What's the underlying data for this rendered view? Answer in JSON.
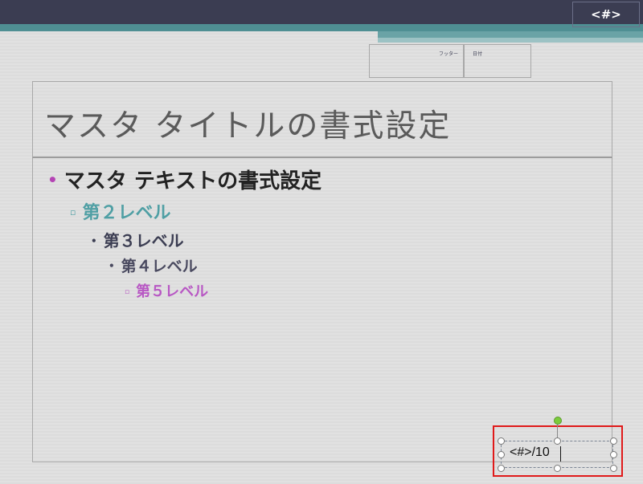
{
  "header": {
    "slide_number_placeholder": "<#>"
  },
  "footer_boxes": {
    "footer_label": "フッター",
    "date_label": "日付"
  },
  "title": {
    "text": "マスタ タイトルの書式設定"
  },
  "body_levels": [
    {
      "bullet": "•",
      "text": "マスタ テキストの書式設定"
    },
    {
      "bullet": "▫",
      "text": "第２レベル"
    },
    {
      "bullet": "•",
      "text": "第３レベル"
    },
    {
      "bullet": "•",
      "text": "第４レベル"
    },
    {
      "bullet": "▫",
      "text": "第５レベル"
    }
  ],
  "selected_textbox": {
    "text": "<#>/10"
  },
  "colors": {
    "header_bar": "#3b3d52",
    "accent_teal": "#4f8f93",
    "highlight": "#e01a1a",
    "level1_bullet": "#b444b4",
    "level2": "#4f9fa4",
    "level5": "#b858c4",
    "rotate_handle": "#7ccc3c"
  }
}
